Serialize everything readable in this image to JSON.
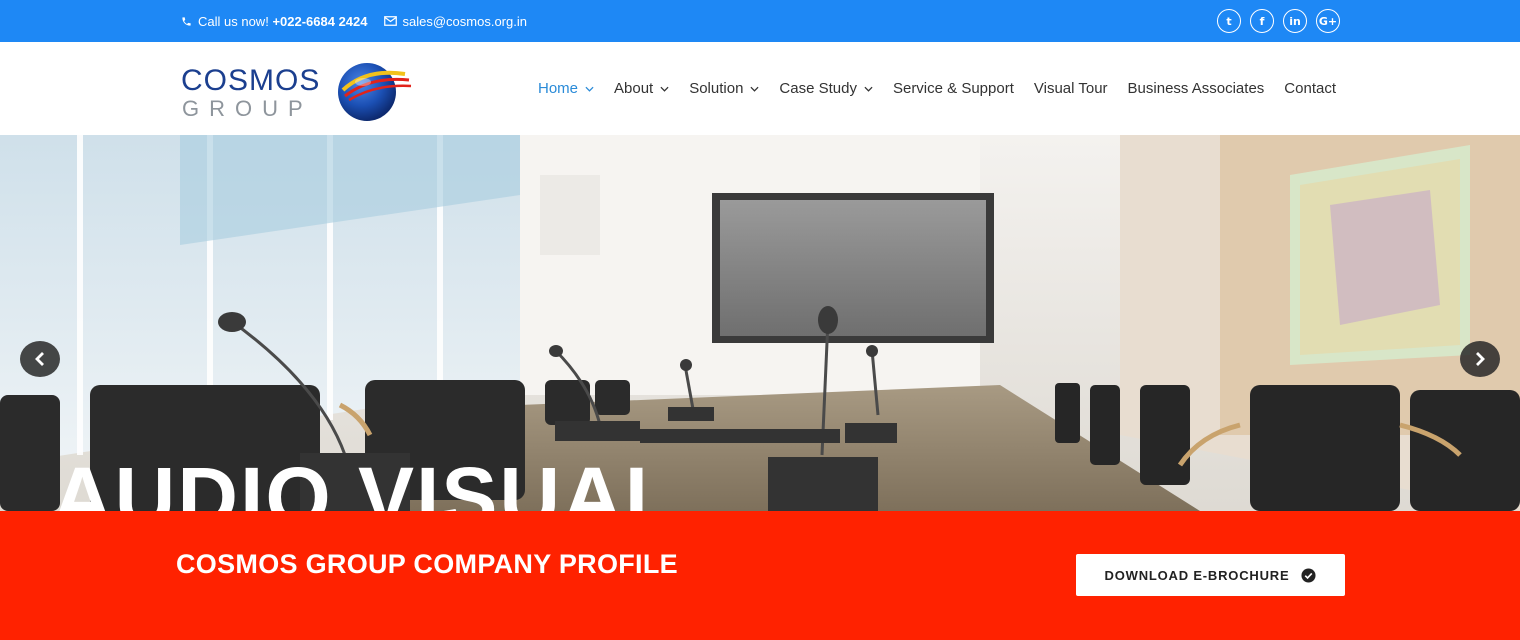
{
  "topbar": {
    "call_label": "Call us now!",
    "phone": "+022-6684 2424",
    "email": "sales@cosmos.org.in",
    "social": [
      {
        "icon": "twitter-icon",
        "glyph": "t"
      },
      {
        "icon": "facebook-icon",
        "glyph": "f"
      },
      {
        "icon": "linkedin-icon",
        "glyph": "in"
      },
      {
        "icon": "google-plus-icon",
        "glyph": "G+"
      }
    ]
  },
  "logo": {
    "line1": "COSMOS",
    "line2": "GROUP"
  },
  "nav": [
    {
      "label": "Home",
      "dropdown": true,
      "active": true
    },
    {
      "label": "About",
      "dropdown": true
    },
    {
      "label": "Solution",
      "dropdown": true
    },
    {
      "label": "Case Study",
      "dropdown": true
    },
    {
      "label": "Service & Support",
      "dropdown": false
    },
    {
      "label": "Visual Tour",
      "dropdown": false
    },
    {
      "label": "Business Associates",
      "dropdown": false
    },
    {
      "label": "Contact",
      "dropdown": false
    }
  ],
  "hero": {
    "caption": "AUDIO VISUAL"
  },
  "profile": {
    "title": "COSMOS GROUP COMPANY PROFILE",
    "button_label": "DOWNLOAD E-BROCHURE"
  },
  "colors": {
    "topbar": "#1e88f5",
    "band": "#ff2200",
    "nav_active": "#2a8bd8",
    "logo_blue": "#1b3f8f"
  }
}
